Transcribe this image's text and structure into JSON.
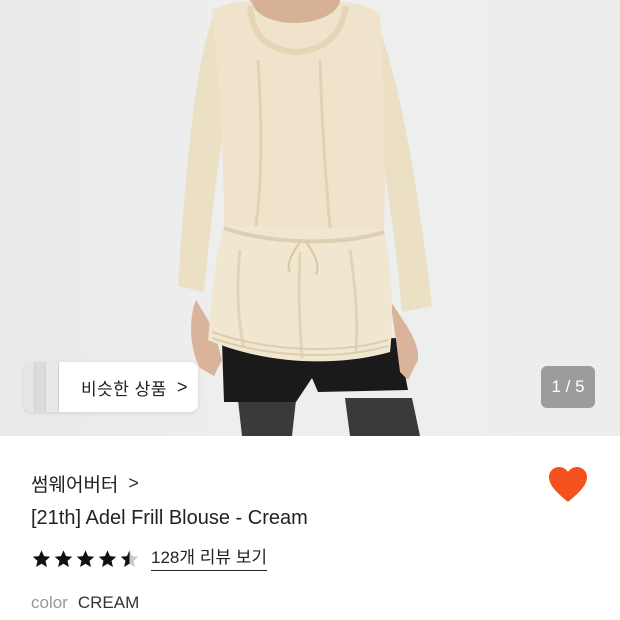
{
  "gallery": {
    "similar_label": "비슷한 상품",
    "similar_chevron": ">",
    "counter": "1 / 5"
  },
  "product": {
    "brand": "썸웨어버터",
    "brand_chevron": ">",
    "title": "[21th] Adel Frill Blouse - Cream",
    "rating": 4.5,
    "reviews_link": "128개 리뷰 보기",
    "color_label": "color",
    "color_value": "CREAM",
    "wishlisted": true
  },
  "colors": {
    "heart": "#f4511e",
    "star": "#111111",
    "star_empty": "#c9c9c9",
    "blouse": "#efe4cb",
    "shorts": "#1a1a1a"
  },
  "icons": {
    "heart": "heart-icon",
    "star": "star-icon",
    "chevron": "chevron-right-icon"
  }
}
